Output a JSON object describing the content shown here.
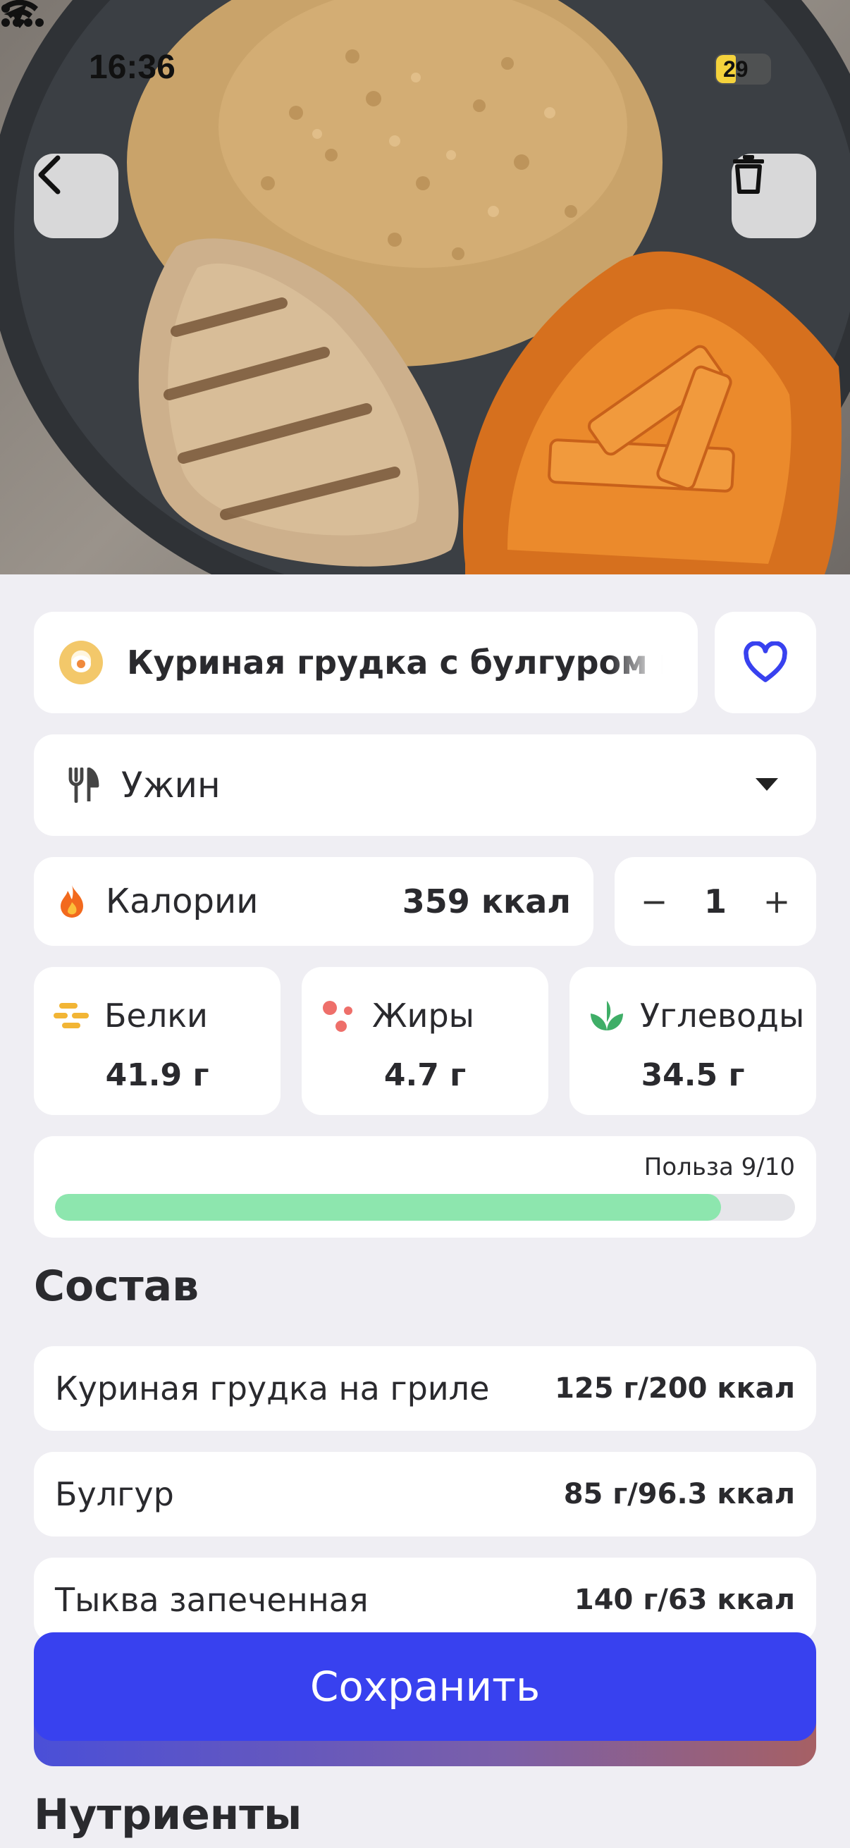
{
  "status_bar": {
    "time": "16:36",
    "battery": "29"
  },
  "dish": {
    "name": "Куриная грудка с булгуром и тыквой"
  },
  "meal": {
    "label": "Ужин"
  },
  "calories": {
    "label": "Калории",
    "value": "359 ккал"
  },
  "quantity": {
    "minus": "−",
    "value": "1",
    "plus": "+"
  },
  "macros": {
    "protein": {
      "label": "Белки",
      "value": "41.9 г",
      "color": "#f2b535"
    },
    "fat": {
      "label": "Жиры",
      "value": "4.7 г",
      "color": "#ee6f6a"
    },
    "carbs": {
      "label": "Углеводы",
      "value": "34.5 г",
      "color": "#3fae67"
    }
  },
  "benefit": {
    "label": "Польза 9/10",
    "score": 9,
    "max": 10,
    "color": "#8de6ae"
  },
  "composition": {
    "title": "Состав",
    "items": [
      {
        "name": "Куриная грудка на гриле",
        "amount": "125 г/200 ккал"
      },
      {
        "name": "Булгур",
        "amount": "85 г/96.3 ккал"
      },
      {
        "name": "Тыква запеченная",
        "amount": "140 г/63 ккал"
      }
    ]
  },
  "save_button": {
    "label": "Сохранить",
    "color": "#3841ef"
  },
  "nutrients": {
    "title": "Нутриенты"
  },
  "icons": {
    "back": "chevron-left-icon",
    "delete": "trash-icon",
    "favorite": "heart-icon",
    "meal": "fork-knife-icon",
    "calories": "flame-icon"
  }
}
